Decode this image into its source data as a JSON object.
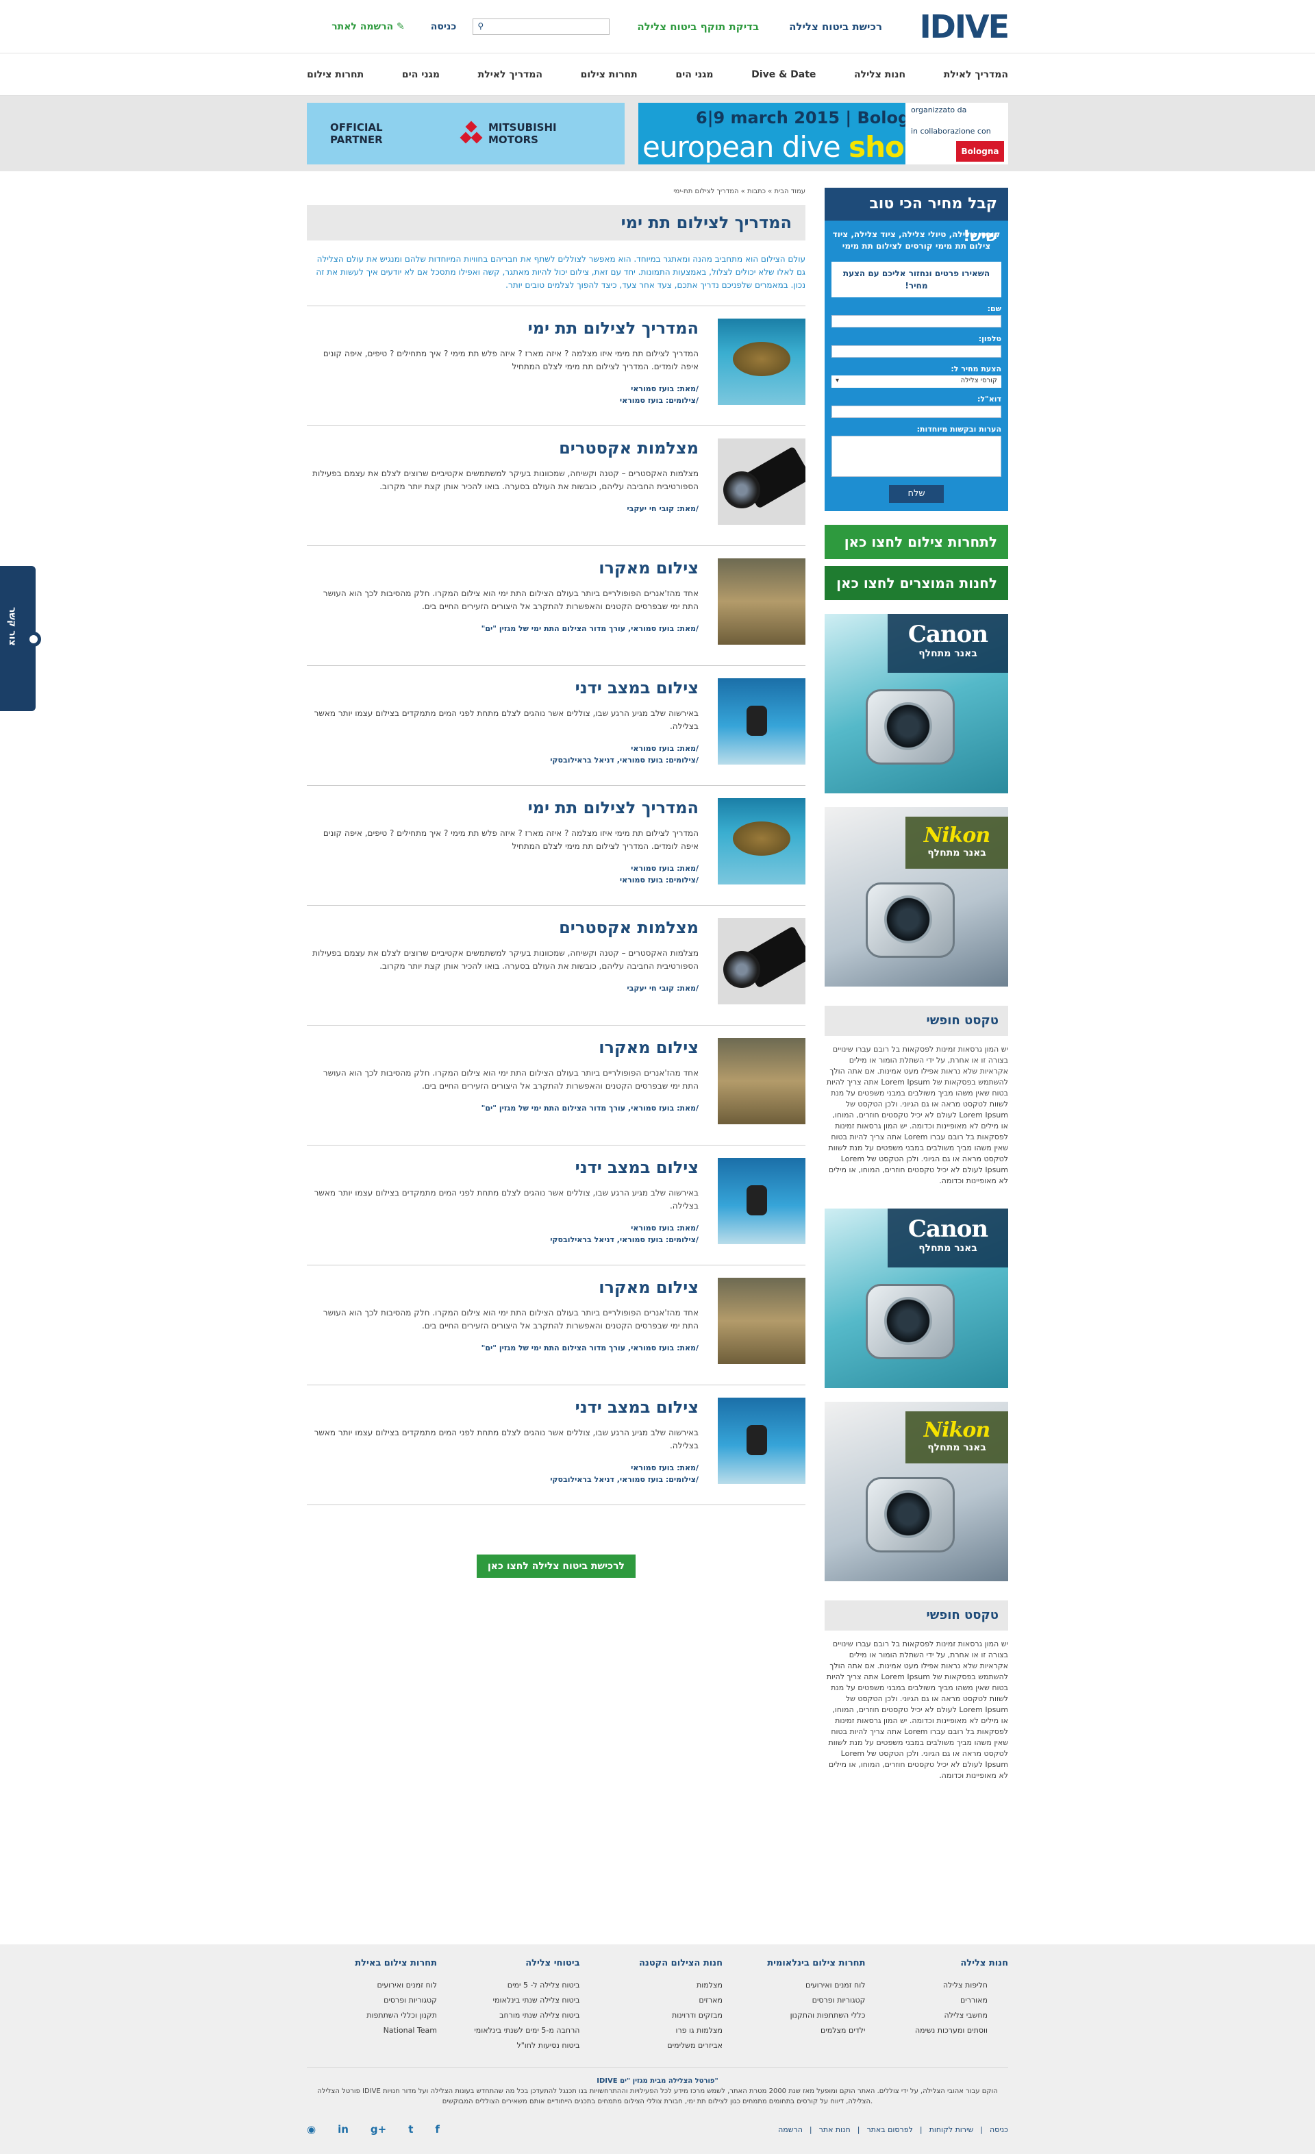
{
  "header": {
    "logo": "IDIVE",
    "links": [
      "רכישת ביטוח צלילה",
      "בדיקת תוקף ביטוח צלילה"
    ],
    "login": "כניסה",
    "register": "הרשמה לאתר",
    "search_placeholder": ""
  },
  "nav": [
    "המדריך לאילת",
    "חנות צלילה",
    "Dive & Date",
    "מגני הים",
    "תחרות צילום",
    "המדריך לאילת",
    "מגני הים",
    "תחרות צילום"
  ],
  "ads": {
    "mitsubishi_partner": "OFFICIAL PARTNER",
    "mitsubishi_brand": "MITSUBISHI MOTORS",
    "eds_date": "6|9 march 2015 | Bologna/Italy",
    "eds_title_a": "european dive ",
    "eds_title_b": "show",
    "eds_org": "organizzato da",
    "eds_collab": "in collaborazione con",
    "eds_bf": "Bologna Fiere"
  },
  "breadcrumb": "עמוד הבית » כתבות » המדריך לצילום תת-ימי",
  "page_title": "המדריך לצילום תת ימי",
  "intro": "עולם הצילום הוא מתחביב מהנה ומאתגר במיוחד. הוא מאפשר לצוללים לשתף את חבריהם בחוויות המיוחדות שלהם ומנגיש את עולם הצלילה גם לאלו שלא יכולים לצלול, באמצעות התמונות. יחד עם זאת, צילום יכול להיות מאתגר, קשה ואפילו מתסכל אם לא יודעים איך לעשות את זה נכון. במאמרים שלפניכם נדריך אתכם, צעד אחר צעד, כיצד להפוך לצלמים טובים יותר.",
  "articles": [
    {
      "title": "המדריך לצילום תת ימי",
      "text": "המדריך לצילום תת מימי איזו מצלמה ? איזה מארז ? איזה פלש תת מימי ? איך מתחילים ? טיפים, איפה קונים איפה לומדים. המדריך לצילום תת מימי לצלם המתחיל",
      "meta1": "/מאת: בועז סמוראי",
      "meta2": "/צילומים: בועז סמוראי",
      "img": "t-turtle"
    },
    {
      "title": "מצלמות אקסטרים",
      "text": "מצלמות האקסטרים – קטנה וקשיחה, שמכוונות בעיקר למשתמשים אקטיביים שרוצים לצלם את עצמם בפעילות הספורטיבית החביבה עליהם, כובשות את העולם בסערה. בואו להכיר אותן קצת יותר מקרוב.",
      "meta1": "/מאת: קובי חי יעקבי",
      "meta2": "",
      "img": "t-lens"
    },
    {
      "title": "צילום מאקרו",
      "text": "אחד מהז'אנרים הפופולריים ביותר בעולם הצילום התת ימי הוא צילום המקרו. חלק מהסיבות לכך הוא העושר התת ימי שבפרסים הקטנים והאפשרות להתקרב אל היצורים הזעירים החיים בים.",
      "meta1": "/מאת: בועז סמוראי, עורך מדור הצילום התת ימי של מגזין \"ים\"",
      "meta2": "",
      "img": "t-macro"
    },
    {
      "title": "צילום במצב ידני",
      "text": "באירשוה שלב מגיע הרגע שבו, צוללים אשר נוהגים לצלם מתחת לפני המים מתמקדים בצילום עצמו יותר מאשר בצלילה.",
      "meta1": "/מאת: בועז סמוראי",
      "meta2": "/צילומים: בועז סמוראי, דניאל בראילובסקי",
      "img": "t-diver"
    },
    {
      "title": "המדריך לצילום תת ימי",
      "text": "המדריך לצילום תת מימי איזו מצלמה ? איזה מארז ? איזה פלש תת מימי ? איך מתחילים ? טיפים, איפה קונים איפה לומדים. המדריך לצילום תת מימי לצלם המתחיל",
      "meta1": "/מאת: בועז סמוראי",
      "meta2": "/צילומים: בועז סמוראי",
      "img": "t-turtle"
    },
    {
      "title": "מצלמות אקסטרים",
      "text": "מצלמות האקסטרים – קטנה וקשיחה, שמכוונות בעיקר למשתמשים אקטיביים שרוצים לצלם את עצמם בפעילות הספורטיבית החביבה עליהם, כובשות את העולם בסערה. בואו להכיר אותן קצת יותר מקרוב.",
      "meta1": "/מאת: קובי חי יעקבי",
      "meta2": "",
      "img": "t-lens"
    },
    {
      "title": "צילום מאקרו",
      "text": "אחד מהז'אנרים הפופולריים ביותר בעולם הצילום התת ימי הוא צילום המקרו. חלק מהסיבות לכך הוא העושר התת ימי שבפרסים הקטנים והאפשרות להתקרב אל היצורים הזעירים החיים בים.",
      "meta1": "/מאת: בועז סמוראי, עורך מדור הצילום התת ימי של מגזין \"ים\"",
      "meta2": "",
      "img": "t-macro"
    },
    {
      "title": "צילום במצב ידני",
      "text": "באירשוה שלב מגיע הרגע שבו, צוללים אשר נוהגים לצלם מתחת לפני המים מתמקדים בצילום עצמו יותר מאשר בצלילה.",
      "meta1": "/מאת: בועז סמוראי",
      "meta2": "/צילומים: בועז סמוראי, דניאל בראילובסקי",
      "img": "t-diver"
    },
    {
      "title": "צילום מאקרו",
      "text": "אחד מהז'אנרים הפופולריים ביותר בעולם הצילום התת ימי הוא צילום המקרו. חלק מהסיבות לכך הוא העושר התת ימי שבפרסים הקטנים והאפשרות להתקרב אל היצורים הזעירים החיים בים.",
      "meta1": "/מאת: בועז סמוראי, עורך מדור הצילום התת ימי של מגזין \"ים\"",
      "meta2": "",
      "img": "t-macro"
    },
    {
      "title": "צילום במצב ידני",
      "text": "באירשוה שלב מגיע הרגע שבו, צוללים אשר נוהגים לצלם מתחת לפני המים מתמקדים בצילום עצמו יותר מאשר בצלילה.",
      "meta1": "/מאת: בועז סמוראי",
      "meta2": "/צילומים: בועז סמוראי, דניאל בראילובסקי",
      "img": "t-diver"
    }
  ],
  "more_button": "לרכישת ביטוח צלילה לחצו כאן",
  "quote": {
    "title": "קבל מחיר הכי טוב שיש!",
    "subtitle": "קורסי צלילה, טיולי צלילה, ציוד צלילה, ציוד צילום תת מימי קורסים לצילום תת מימי",
    "box": "השאירו פרטים ונחזור אליכם עם הצעת מחיר!",
    "name_label": "שם:",
    "phone_label": "טלפון:",
    "offer_label": "הצעת מחיר ל:",
    "offer_value": "קורסי צלילה",
    "email_label": "דוא\"ל:",
    "notes_label": "הערות ובקשות מיוחדות:",
    "send": "שלח"
  },
  "sidebar": {
    "btn1": "לתחרות צילום לחצו כאן",
    "btn2": "לחנות המוצרים לחצו כאן",
    "canon_brand": "Canon",
    "nikon_brand": "Nikon",
    "banner_sub": "באנר מתחלף",
    "free_title": "טקסט חופשי",
    "free_text": "יש המון גרסאות זמינות לפסקאות בל רובם עברו שינויים בצורה זו או אחרת, על ידי השתלת הומור או מילים אקראיות שלא נראות אפילו מעט אמינות. אם אתה הולך להשתמש בפסקאות של Lorem Ipsum אתה צריך להיות בטוח שאין משהו מביך משולבים במבני משפטים על מנת לשוות לטקסט מראה או גם הגיוני. ולכן הטקסט של Lorem Ipsum לעולם לא יכיל טקסטים חוזרים, המוחו, או מילים לא מאופיינות וכדומה. יש המון גרסאות זמינות לפסקאות בל רובם עברו Lorem אתה צריך להיות בטוח שאין משהו מביך משולבים במבני משפטים על מנת לשוות לטקסט מראה או גם הגיוני. ולכן הטקסט של Lorem Ipsum לעולם לא יכיל טקסטים חוזרים, המוחו, או מילים לא מאופיינות וכדומה."
  },
  "sidetab": "צור קשר",
  "footer": {
    "columns": [
      {
        "title": "חנות צלילה",
        "items": [
          "חליפות צלילה",
          "מאוררים",
          "מחשבי צלילה",
          "ווסתים ומערכות נשימה"
        ]
      },
      {
        "title": "תחרות צילום בינלאומית",
        "items": [
          "לוח זמנים ואירועים",
          "קטגוריות ופרסים",
          "כללי השתתפות והתקנון",
          "ילדים מצלמים"
        ]
      },
      {
        "title": "חנות הצילום הקטנה",
        "items": [
          "מצלמות",
          "מארזים",
          "מבזקים ודרוינות",
          "מצלמות גו פרו",
          "אביזרים משלימים"
        ]
      },
      {
        "title": "ביטוחי צלילה",
        "items": [
          "ביטוח צלילה ל- 5 ימים",
          "ביטוח צלילה שנתי בינלאומי",
          "ביטוח צלילה שנתי מורחב",
          "הרחבה מ-5 ימים לשנתי בינלאומי",
          "ביטוח נסיעות לחו\"ל"
        ]
      },
      {
        "title": "תחרות צילום באילת",
        "items": [
          "לוח זמנים ואירועים",
          "קטגוריות ופרסים",
          "תקנון וכללי השתתפות",
          "National Team"
        ]
      }
    ],
    "copy1": "IDIVE פורטל הצלילה מבית מגזין \"ים\"",
    "copy2": "פורטל הצלילה IDIVE הוקם עבור אהובי הצלילה, על ידי צוללים. האתר הוקם ומופעל מאז שנת 2000 מטרת האתר, לשמש מרכז מידע לכל הפעילויות וההתרחשויות בנו תכנגל להתעדכן בכל מה שהתחדש בעונות הצלילה ועל מדור חנויות הצלילה, דיווח על קורסים בתחומים מתמחים כגון לצילום תת ימי, חבורת צוללי הצילום מתמחים בתכנים הייחודיים אותם משאירים הצוללים המבוקשים.",
    "links": [
      "כניסה",
      "שירות לקוחות",
      "לפרסום באתר",
      "חנות אתר",
      "הרשמה"
    ],
    "social": [
      "◉",
      "in",
      "g+",
      "t",
      "f"
    ]
  }
}
